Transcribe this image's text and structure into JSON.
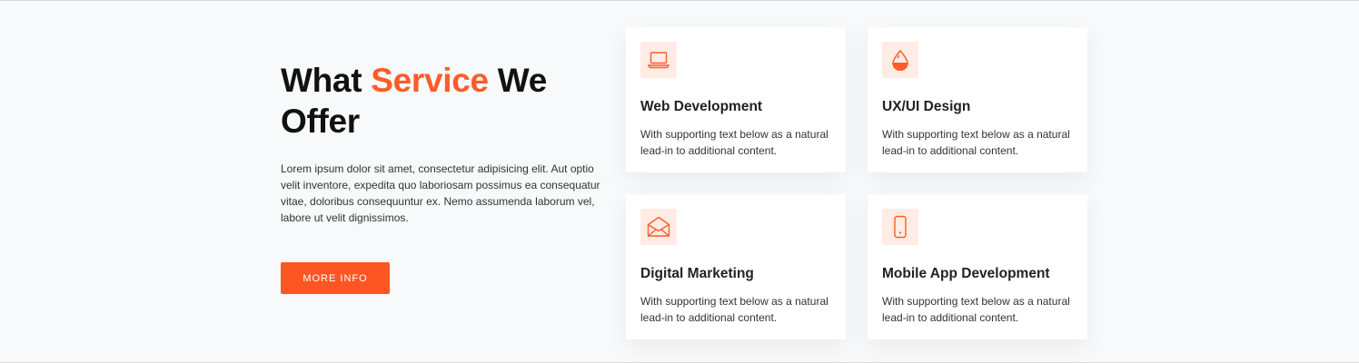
{
  "section": {
    "heading_part1": "What ",
    "heading_accent": "Service",
    "heading_part2": " We Offer",
    "description": "Lorem ipsum dolor sit amet, consectetur adipisicing elit. Aut optio velit inventore, expedita quo laboriosam possimus ea consequatur vitae, doloribus consequuntur ex. Nemo assumenda laborum vel, labore ut velit dignissimos.",
    "button_label": "MORE INFO"
  },
  "services": [
    {
      "icon": "laptop-icon",
      "title": "Web Development",
      "text": "With supporting text below as a natural lead-in to additional content."
    },
    {
      "icon": "droplet-icon",
      "title": "UX/UI Design",
      "text": "With supporting text below as a natural lead-in to additional content."
    },
    {
      "icon": "envelope-open-icon",
      "title": "Digital Marketing",
      "text": "With supporting text below as a natural lead-in to additional content."
    },
    {
      "icon": "phone-icon",
      "title": "Mobile App Development",
      "text": "With supporting text below as a natural lead-in to additional content."
    }
  ],
  "colors": {
    "accent": "#fd5c28",
    "icon_bg": "#ffece5",
    "page_bg": "#f8f9fa"
  }
}
